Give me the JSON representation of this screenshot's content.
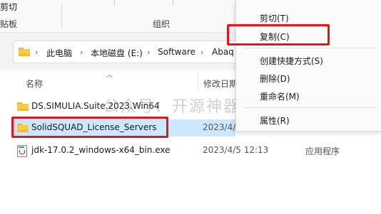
{
  "ribbon": {
    "cut_label": "剪切",
    "clipboard_label": "贴板",
    "organize_label": "组织"
  },
  "address": {
    "crumbs": [
      "此电脑",
      "本地磁盘 (E:)",
      "Software",
      "Abaq"
    ]
  },
  "columns": {
    "name": "名称",
    "date": "修改日期"
  },
  "rows": [
    {
      "name": "DS.SIMULIA.Suite.2023.Win64",
      "date": "",
      "type": "",
      "icon": "folder-icon"
    },
    {
      "name": "SolidSQUAD_License_Servers",
      "date": "2023/4/",
      "type": "",
      "icon": "folder-icon"
    },
    {
      "name": "jdk-17.0.2_windows-x64_bin.exe",
      "date": "2023/4/5 12:13",
      "type": "应用程序",
      "icon": "java-exe-icon"
    }
  ],
  "context_menu": {
    "items": [
      "剪切(T)",
      "复制(C)",
      "创建快捷方式(S)",
      "删除(D)",
      "重命名(M)",
      "属性(R)"
    ]
  },
  "watermark": "公众号：开源神器",
  "colors": {
    "highlight": "#e8131b",
    "selection": "#cce8ff",
    "folder": "#f7c948"
  }
}
